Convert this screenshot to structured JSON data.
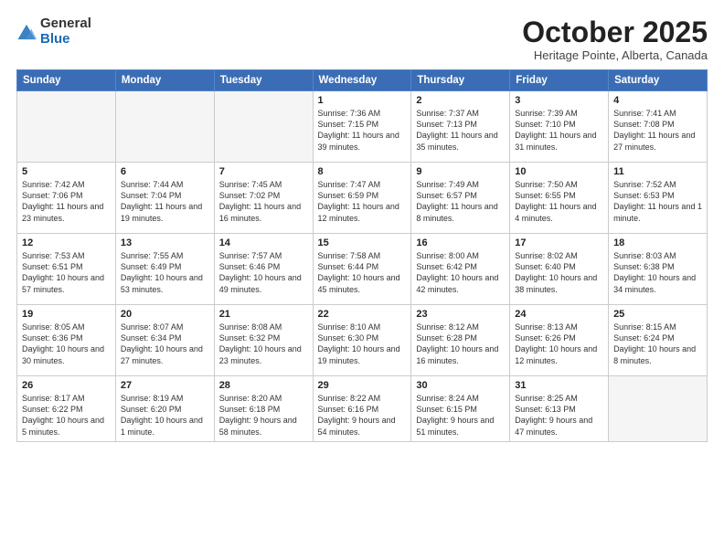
{
  "logo": {
    "general": "General",
    "blue": "Blue"
  },
  "header": {
    "month": "October 2025",
    "location": "Heritage Pointe, Alberta, Canada"
  },
  "weekdays": [
    "Sunday",
    "Monday",
    "Tuesday",
    "Wednesday",
    "Thursday",
    "Friday",
    "Saturday"
  ],
  "weeks": [
    [
      {
        "day": "",
        "info": ""
      },
      {
        "day": "",
        "info": ""
      },
      {
        "day": "",
        "info": ""
      },
      {
        "day": "1",
        "info": "Sunrise: 7:36 AM\nSunset: 7:15 PM\nDaylight: 11 hours\nand 39 minutes."
      },
      {
        "day": "2",
        "info": "Sunrise: 7:37 AM\nSunset: 7:13 PM\nDaylight: 11 hours\nand 35 minutes."
      },
      {
        "day": "3",
        "info": "Sunrise: 7:39 AM\nSunset: 7:10 PM\nDaylight: 11 hours\nand 31 minutes."
      },
      {
        "day": "4",
        "info": "Sunrise: 7:41 AM\nSunset: 7:08 PM\nDaylight: 11 hours\nand 27 minutes."
      }
    ],
    [
      {
        "day": "5",
        "info": "Sunrise: 7:42 AM\nSunset: 7:06 PM\nDaylight: 11 hours\nand 23 minutes."
      },
      {
        "day": "6",
        "info": "Sunrise: 7:44 AM\nSunset: 7:04 PM\nDaylight: 11 hours\nand 19 minutes."
      },
      {
        "day": "7",
        "info": "Sunrise: 7:45 AM\nSunset: 7:02 PM\nDaylight: 11 hours\nand 16 minutes."
      },
      {
        "day": "8",
        "info": "Sunrise: 7:47 AM\nSunset: 6:59 PM\nDaylight: 11 hours\nand 12 minutes."
      },
      {
        "day": "9",
        "info": "Sunrise: 7:49 AM\nSunset: 6:57 PM\nDaylight: 11 hours\nand 8 minutes."
      },
      {
        "day": "10",
        "info": "Sunrise: 7:50 AM\nSunset: 6:55 PM\nDaylight: 11 hours\nand 4 minutes."
      },
      {
        "day": "11",
        "info": "Sunrise: 7:52 AM\nSunset: 6:53 PM\nDaylight: 11 hours\nand 1 minute."
      }
    ],
    [
      {
        "day": "12",
        "info": "Sunrise: 7:53 AM\nSunset: 6:51 PM\nDaylight: 10 hours\nand 57 minutes."
      },
      {
        "day": "13",
        "info": "Sunrise: 7:55 AM\nSunset: 6:49 PM\nDaylight: 10 hours\nand 53 minutes."
      },
      {
        "day": "14",
        "info": "Sunrise: 7:57 AM\nSunset: 6:46 PM\nDaylight: 10 hours\nand 49 minutes."
      },
      {
        "day": "15",
        "info": "Sunrise: 7:58 AM\nSunset: 6:44 PM\nDaylight: 10 hours\nand 45 minutes."
      },
      {
        "day": "16",
        "info": "Sunrise: 8:00 AM\nSunset: 6:42 PM\nDaylight: 10 hours\nand 42 minutes."
      },
      {
        "day": "17",
        "info": "Sunrise: 8:02 AM\nSunset: 6:40 PM\nDaylight: 10 hours\nand 38 minutes."
      },
      {
        "day": "18",
        "info": "Sunrise: 8:03 AM\nSunset: 6:38 PM\nDaylight: 10 hours\nand 34 minutes."
      }
    ],
    [
      {
        "day": "19",
        "info": "Sunrise: 8:05 AM\nSunset: 6:36 PM\nDaylight: 10 hours\nand 30 minutes."
      },
      {
        "day": "20",
        "info": "Sunrise: 8:07 AM\nSunset: 6:34 PM\nDaylight: 10 hours\nand 27 minutes."
      },
      {
        "day": "21",
        "info": "Sunrise: 8:08 AM\nSunset: 6:32 PM\nDaylight: 10 hours\nand 23 minutes."
      },
      {
        "day": "22",
        "info": "Sunrise: 8:10 AM\nSunset: 6:30 PM\nDaylight: 10 hours\nand 19 minutes."
      },
      {
        "day": "23",
        "info": "Sunrise: 8:12 AM\nSunset: 6:28 PM\nDaylight: 10 hours\nand 16 minutes."
      },
      {
        "day": "24",
        "info": "Sunrise: 8:13 AM\nSunset: 6:26 PM\nDaylight: 10 hours\nand 12 minutes."
      },
      {
        "day": "25",
        "info": "Sunrise: 8:15 AM\nSunset: 6:24 PM\nDaylight: 10 hours\nand 8 minutes."
      }
    ],
    [
      {
        "day": "26",
        "info": "Sunrise: 8:17 AM\nSunset: 6:22 PM\nDaylight: 10 hours\nand 5 minutes."
      },
      {
        "day": "27",
        "info": "Sunrise: 8:19 AM\nSunset: 6:20 PM\nDaylight: 10 hours\nand 1 minute."
      },
      {
        "day": "28",
        "info": "Sunrise: 8:20 AM\nSunset: 6:18 PM\nDaylight: 9 hours\nand 58 minutes."
      },
      {
        "day": "29",
        "info": "Sunrise: 8:22 AM\nSunset: 6:16 PM\nDaylight: 9 hours\nand 54 minutes."
      },
      {
        "day": "30",
        "info": "Sunrise: 8:24 AM\nSunset: 6:15 PM\nDaylight: 9 hours\nand 51 minutes."
      },
      {
        "day": "31",
        "info": "Sunrise: 8:25 AM\nSunset: 6:13 PM\nDaylight: 9 hours\nand 47 minutes."
      },
      {
        "day": "",
        "info": ""
      }
    ]
  ]
}
